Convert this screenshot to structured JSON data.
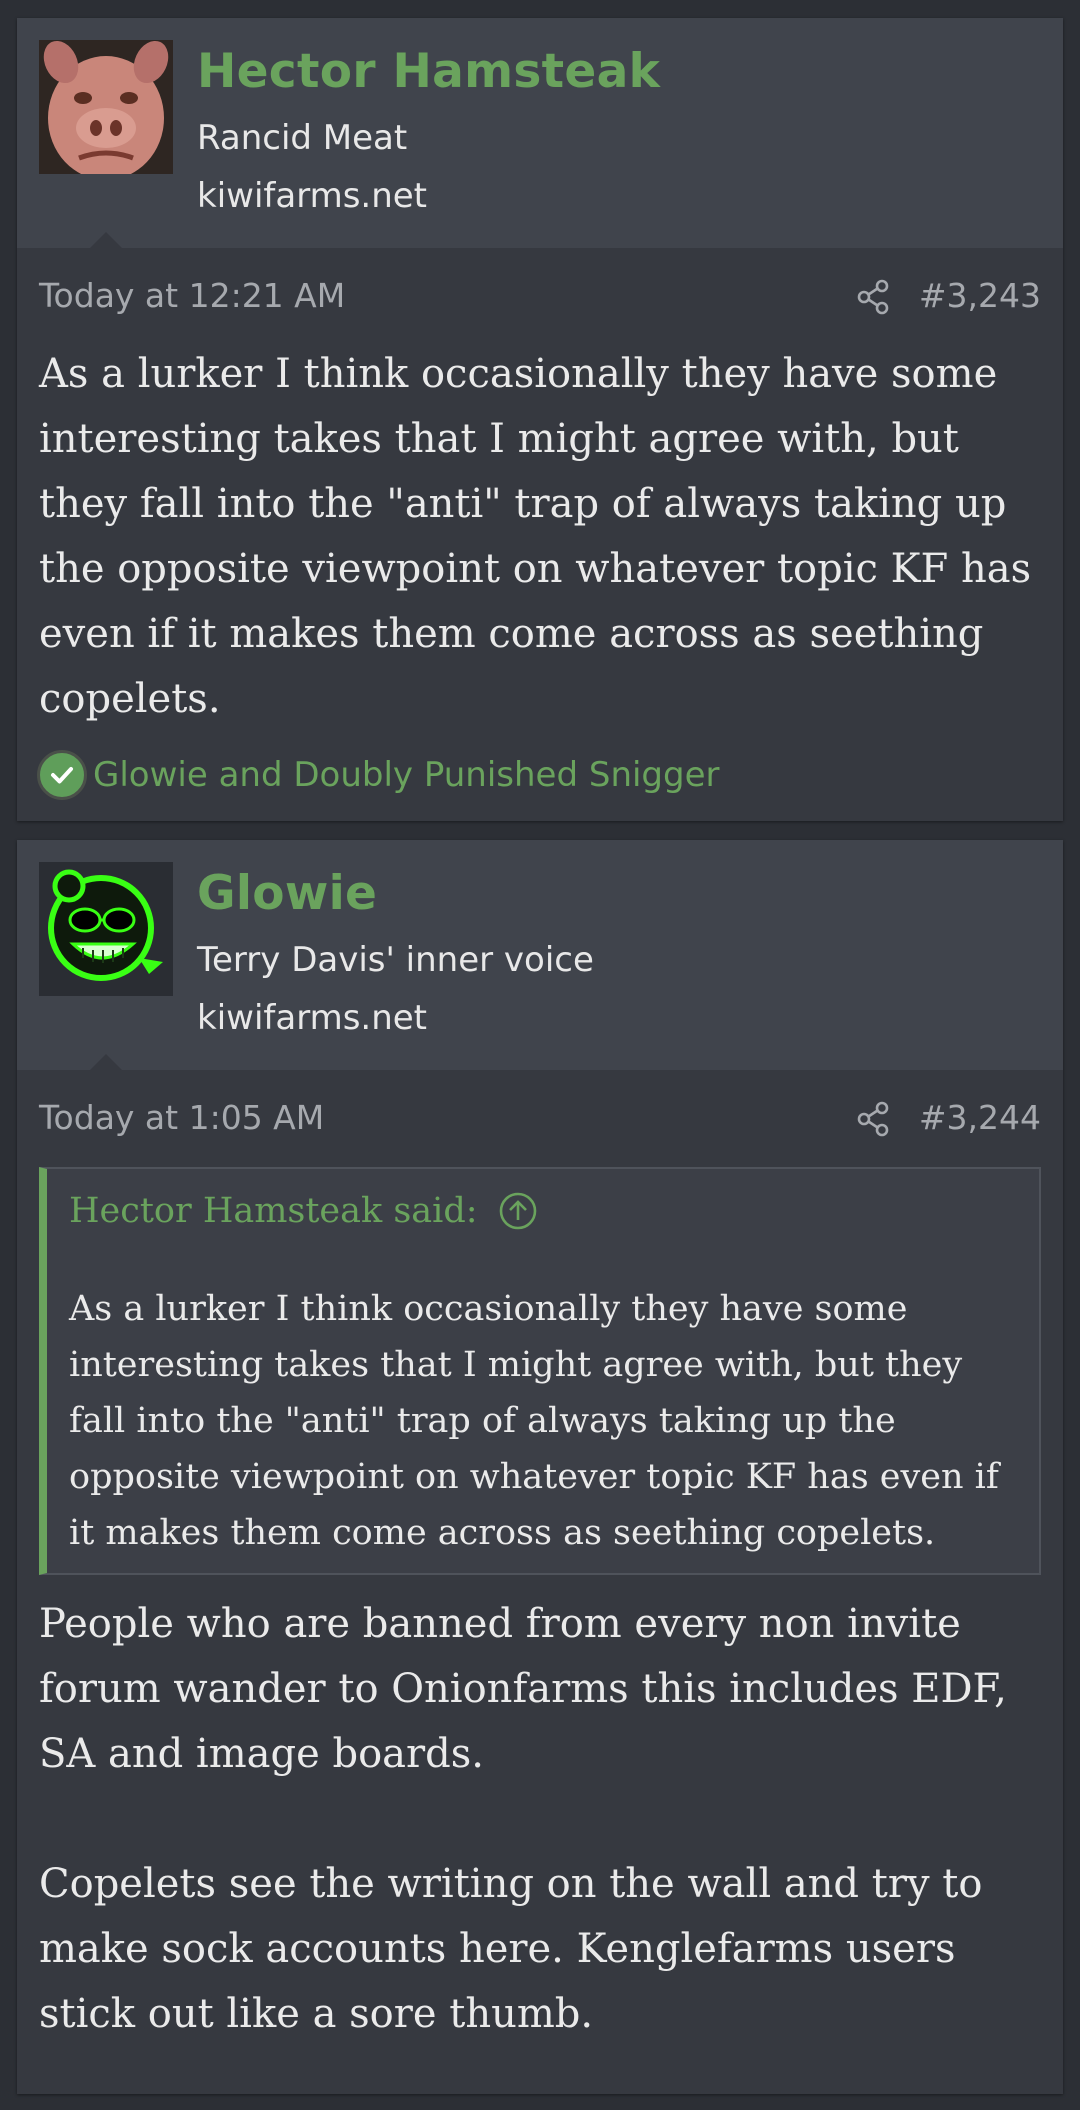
{
  "posts": [
    {
      "author": "Hector Hamsteak",
      "user_title": "Rancid Meat",
      "user_site": "kiwifarms.net",
      "avatar_icon": "pig-mask-avatar",
      "timestamp": "Today at 12:21 AM",
      "post_number": "#3,243",
      "body": "As a lurker I think occasionally they have some interesting takes that I might agree with, but they fall into the \"anti\" trap of always taking up the opposite viewpoint on whatever topic KF has even if it makes them come across as seething copelets.",
      "reactions": "Glowie and Doubly Punished Snigger"
    },
    {
      "author": "Glowie",
      "user_title": "Terry Davis' inner voice",
      "user_site": "kiwifarms.net",
      "avatar_icon": "glowing-green-face-avatar",
      "timestamp": "Today at 1:05 AM",
      "post_number": "#3,244",
      "quote_header": "Hector Hamsteak said:",
      "quote_body": "As a lurker I think occasionally they have some interesting takes that I might agree with, but they fall into the \"anti\" trap of always taking up the opposite viewpoint on whatever topic KF has even if it makes them come across as seething copelets.",
      "body_paragraphs": [
        "People who are banned from every non invite forum wander to Onionfarms this includes EDF, SA and image boards.",
        "Copelets see the writing on the wall and try to make sock accounts here. Kenglefarms users stick out like a sore thumb."
      ]
    }
  ],
  "colors": {
    "accent_green": "#6aa35d",
    "background": "#2c2f35",
    "post_background": "#363940",
    "user_block_background": "#40444c"
  }
}
